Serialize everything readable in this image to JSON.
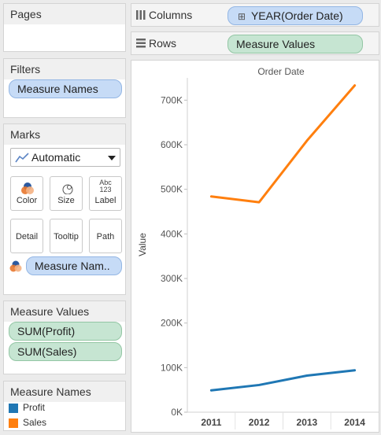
{
  "pages": {
    "title": "Pages"
  },
  "filters": {
    "title": "Filters",
    "pills": [
      "Measure Names"
    ]
  },
  "marks": {
    "title": "Marks",
    "dropdown_value": "Automatic",
    "buttons": [
      "Color",
      "Size",
      "Label",
      "Detail",
      "Tooltip",
      "Path"
    ],
    "label_icon_text": [
      "Abc",
      "123"
    ],
    "color_pill": "Measure Nam.."
  },
  "measure_values": {
    "title": "Measure Values",
    "pills": [
      "SUM(Profit)",
      "SUM(Sales)"
    ]
  },
  "legend": {
    "title": "Measure Names",
    "items": [
      {
        "label": "Profit",
        "color": "#1f77b4"
      },
      {
        "label": "Sales",
        "color": "#ff7f0e"
      }
    ]
  },
  "shelves": {
    "columns_label": "Columns",
    "columns_pill": "YEAR(Order Date)",
    "columns_pill_prefix": "⊞",
    "rows_label": "Rows",
    "rows_pill": "Measure Values"
  },
  "chart_data": {
    "type": "line",
    "title": "Order Date",
    "xlabel": "",
    "ylabel": "Value",
    "categories": [
      "2011",
      "2012",
      "2013",
      "2014"
    ],
    "ylim": [
      0,
      750000
    ],
    "yticks": [
      0,
      100000,
      200000,
      300000,
      400000,
      500000,
      600000,
      700000
    ],
    "ytick_labels": [
      "0K",
      "100K",
      "200K",
      "300K",
      "400K",
      "500K",
      "600K",
      "700K"
    ],
    "series": [
      {
        "name": "Profit",
        "color": "#1f77b4",
        "values": [
          49000,
          61000,
          82000,
          94000
        ]
      },
      {
        "name": "Sales",
        "color": "#ff7f0e",
        "values": [
          484000,
          471000,
          609000,
          733000
        ]
      }
    ]
  }
}
